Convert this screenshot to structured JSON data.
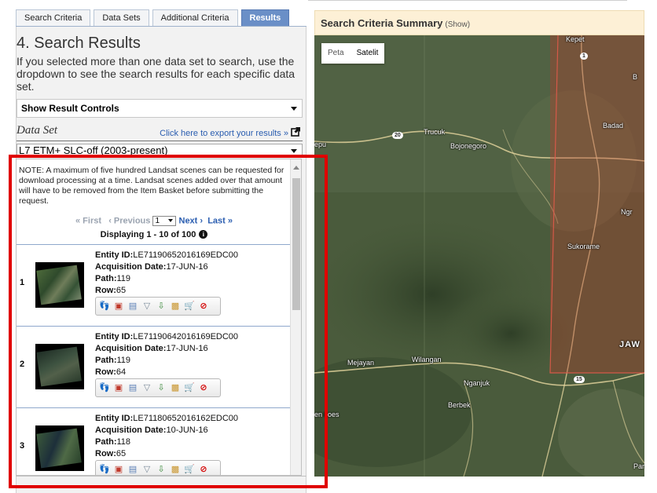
{
  "tabs": [
    {
      "label": "Search Criteria"
    },
    {
      "label": "Data Sets"
    },
    {
      "label": "Additional Criteria"
    },
    {
      "label": "Results",
      "active": true
    }
  ],
  "section": {
    "title": "4. Search Results",
    "description": "If you selected more than one data set to search, use the dropdown to see the search results for each specific data set."
  },
  "result_controls": {
    "label": "Show Result Controls"
  },
  "dataset": {
    "label": "Data Set",
    "export_label": "Click here to export your results »",
    "selected": "L7 ETM+ SLC-off (2003-present)"
  },
  "results": {
    "note": "NOTE: A maximum of five hundred Landsat scenes can be requested for download processing at a time. Landsat scenes added over that amount will have to be removed from the Item Basket before submitting the request.",
    "pager": {
      "first": "« First",
      "previous": "‹ Previous",
      "page": "1",
      "next": "Next ›",
      "last": "Last »"
    },
    "displaying": "Displaying 1 - 10 of 100",
    "field_labels": {
      "entity": "Entity ID:",
      "date": "Acquisition Date:",
      "path": "Path:",
      "row": "Row:"
    },
    "items": [
      {
        "num": "1",
        "entity_id": "LE71190652016169EDC00",
        "date": "17-JUN-16",
        "path": "119",
        "row": "65"
      },
      {
        "num": "2",
        "entity_id": "LE71190642016169EDC00",
        "date": "17-JUN-16",
        "path": "119",
        "row": "64"
      },
      {
        "num": "3",
        "entity_id": "LE71180652016162EDC00",
        "date": "10-JUN-16",
        "path": "118",
        "row": "65"
      }
    ],
    "toolbar_icons": [
      "footprint-icon",
      "metadata-icon",
      "compare-icon",
      "bulk-download-icon",
      "download-icon",
      "order-icon",
      "cart-icon",
      "exclude-icon"
    ]
  },
  "map": {
    "title": "Search Criteria Summary",
    "show_label": "(Show)",
    "map_type": {
      "map": "Peta",
      "satellite": "Satelit"
    },
    "places": {
      "kepet": "Kepet",
      "badad": "Badad",
      "trucuk": "Trucuk",
      "bojonegoro": "Bojonegoro",
      "ngr": "Ngr",
      "sukorame": "Sukorame",
      "jaw": "JAW",
      "mejayan": "Mejayan",
      "wilangan": "Wilangan",
      "nganjuk": "Nganjuk",
      "berbek": "Berbek",
      "epu": "epu",
      "enkoes": "en koes",
      "par": "Par",
      "b": "B"
    },
    "road_shields": {
      "r1": "1",
      "r20": "20",
      "r15": "15"
    }
  },
  "colors": {
    "active_tab": "#6a8fc7",
    "link": "#2a5db0",
    "annotation": "#e00000",
    "footprint_overlay": "#c0392b"
  }
}
